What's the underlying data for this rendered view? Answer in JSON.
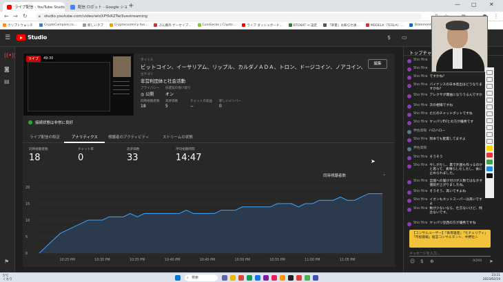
{
  "browser": {
    "tabs": [
      {
        "label": "ライブ配信 - YouTube Studio",
        "favicon_color": "#ff0000"
      },
      {
        "label": "配信 ロボット - Google ショッピング",
        "favicon_color": "#4285f4"
      }
    ],
    "url": "studio.youtube.com/video/wlxXPYkRZTw/livestreaming",
    "bookmarks": [
      "クリプトウォッチ",
      "CryptoCompare.co...",
      "新しいタブ",
      "Cryptocurrency foo...",
      "ぷん番外 ゲーセイブ...",
      "CoinGecko | Crypto...",
      "ライブ ダッシュボード...",
      "BTCNXT ⇒ 設定",
      "「単量」お知らせ通...",
      "MODELX（TESLA）...",
      "Statement 440111..."
    ]
  },
  "studio": {
    "logo_text": "Studio"
  },
  "stream": {
    "live_label": "ライブ",
    "elapsed": "49:30",
    "title_label": "タイトル",
    "title": "ビットコイン、イーサリアム、リップル、カルダノＡＤＡ、トロン、ドージコイン、ノアコイン、ノア...",
    "category_label": "カテゴリ",
    "category": "非営利団体と社会活動",
    "privacy_label": "プライバシー",
    "privacy": "公開",
    "dvr_label": "低遅延の受け取り",
    "dvr": "オン",
    "concurrent_label": "同時視聴者数",
    "concurrent": "18",
    "likes_label": "高評価数",
    "likes": "5",
    "chat_rate_label": "チャットの収益",
    "chat_rate": "−",
    "members_label": "新しいメンバー",
    "members": "0",
    "edit_label": "編集",
    "health": "接続状態は非常に良好"
  },
  "tabs": [
    "ライブ配信の設定",
    "アナリティクス",
    "視聴者のアクティビティ",
    "ストリームの状態"
  ],
  "metrics": [
    {
      "label": "同時視聴者数",
      "value": "18"
    },
    {
      "label": "チャット率",
      "value": "0"
    },
    {
      "label": "高評価数",
      "value": "33"
    },
    {
      "label": "平均視聴時間",
      "value": "14:47"
    }
  ],
  "metric_selector": "同時視聴者数",
  "chart_data": {
    "type": "area",
    "title": "",
    "xlabel": "",
    "ylabel": "",
    "ylim": [
      0,
      20
    ],
    "yticks": [
      0,
      5,
      10,
      15,
      20
    ],
    "xtick_labels": [
      "10:25 PM",
      "10:30 PM",
      "10:35 PM",
      "10:40 PM",
      "10:45 PM",
      "10:50 PM",
      "10:55 PM",
      "11:00 PM",
      "11:05 PM"
    ],
    "x_minutes": [
      0,
      1,
      2,
      3,
      4,
      5,
      6,
      7,
      8,
      9,
      10,
      11,
      12,
      13,
      14,
      15,
      16,
      17,
      18,
      19,
      20,
      21,
      22,
      23,
      24,
      25,
      26,
      27,
      28,
      29,
      30,
      31,
      32,
      33,
      34,
      35,
      36,
      37,
      38,
      39,
      40,
      41,
      42,
      43,
      44,
      45,
      46,
      47,
      48,
      49
    ],
    "values": [
      0,
      2,
      4,
      6,
      7,
      8,
      9,
      10,
      10,
      10,
      11,
      11,
      11,
      12,
      11,
      12,
      12,
      12,
      12,
      12,
      12,
      13,
      12,
      12,
      12,
      12,
      13,
      13,
      13,
      14,
      14,
      14,
      14,
      14,
      15,
      15,
      15,
      14,
      15,
      15,
      16,
      16,
      16,
      17,
      16,
      16,
      17,
      18,
      18,
      18
    ],
    "start_label_minute": 4,
    "grid": true,
    "line_color": "#3ea6ff",
    "fill_color": "#2c3a4d"
  },
  "chat": {
    "header": "トップチャット",
    "messages": [
      {
        "author": "Sho Hira",
        "text": "",
        "avatar": "purple"
      },
      {
        "author": "Sho Hira",
        "text": "",
        "avatar": "purple"
      },
      {
        "author": "Sho Hira",
        "text": "ですかね？",
        "avatar": "purple"
      },
      {
        "author": "Sho Hira",
        "text": "バイナンスの日本進出はどうなりますかね？",
        "avatar": "purple"
      },
      {
        "author": "Sho Hira",
        "text": "アレクサが爆益になりうるんですか",
        "avatar": "purple"
      },
      {
        "author": "Sho Hira",
        "text": "次の相場ですね",
        "avatar": "purple"
      },
      {
        "author": "Sho Hira",
        "text": "ただのチャットボットですね",
        "avatar": "purple"
      },
      {
        "author": "Sho Hira",
        "text": "ヤッパリEVとの方が優秀です",
        "avatar": "purple"
      },
      {
        "author": "伊佐高陽",
        "text": "ハロハロー",
        "avatar": "grey"
      },
      {
        "author": "Sho Hira",
        "text": "残本でも配置してますよ",
        "avatar": "purple"
      },
      {
        "author": "伊佐高陽",
        "text": "",
        "avatar": "grey"
      },
      {
        "author": "Sho Hira",
        "text": "そうそう",
        "avatar": "purple"
      },
      {
        "author": "Sho Hira",
        "text": "今しがたし、裏で外国も作っるのかと思って、素晴らしたしたし、食に止められました。",
        "avatar": "purple"
      },
      {
        "author": "Sho Hira",
        "text": "全国への届け付けが人数ではなかす値段が上がりましたね。",
        "avatar": "purple"
      },
      {
        "author": "Sho Hira",
        "text": "そうそう、高いですよね",
        "avatar": "purple"
      },
      {
        "author": "Sho Hira",
        "text": "イオンもネットスーパーは高いですよ",
        "avatar": "purple"
      },
      {
        "author": "Sho Hira",
        "text": "数が少ないなら、仕方ないけど、残念ないです。",
        "avatar": "purple"
      },
      {
        "author": "Sho Hira",
        "text": "ヤッパリ豆西の方が優秀ですね",
        "avatar": "purple"
      }
    ],
    "pinned": "【コンサルユーザー】「表母連音」「モチェリティ」「市投資戦」経営コンサルタント、中野社ニ",
    "input_placeholder": "メッセージを入力...",
    "char_count": "0/200"
  },
  "taskbar": {
    "weather_temp": "5°C",
    "weather_desc": "くもり",
    "search_label": "検索",
    "time": "23:21",
    "date": "2023/02/19"
  }
}
